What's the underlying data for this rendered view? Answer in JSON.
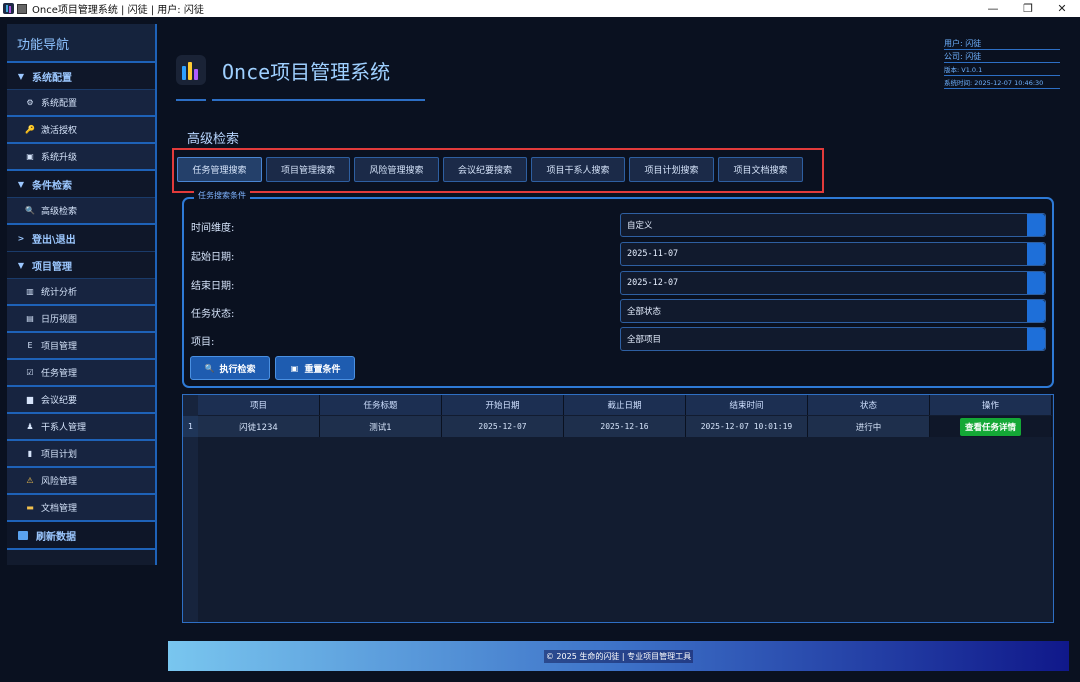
{
  "window": {
    "title": "Once项目管理系统 | 闪徒 | 用户: 闪徒",
    "minimize": "—",
    "maximize": "❐",
    "close": "✕"
  },
  "sidebar": {
    "header": "功能导航",
    "groups": [
      {
        "label": "系统配置",
        "marker": "▼"
      },
      {
        "label": "条件检索",
        "marker": "▼"
      },
      {
        "label": "登出\\退出",
        "marker": ">"
      },
      {
        "label": "项目管理",
        "marker": "▼"
      }
    ],
    "items": [
      {
        "label": "系统配置",
        "icon": "⚙"
      },
      {
        "label": "激活授权",
        "icon": "🔑"
      },
      {
        "label": "系统升级",
        "icon": "▣"
      },
      {
        "label": "高级检索",
        "icon": "🔍"
      },
      {
        "label": "统计分析",
        "icon": "▥"
      },
      {
        "label": "日历视图",
        "icon": "▤"
      },
      {
        "label": "项目管理",
        "icon": "Ε"
      },
      {
        "label": "任务管理",
        "icon": "☑"
      },
      {
        "label": "会议纪要",
        "icon": "▆"
      },
      {
        "label": "干系人管理",
        "icon": "♟"
      },
      {
        "label": "项目计划",
        "icon": "▮"
      },
      {
        "label": "风险管理",
        "icon": "⚠"
      },
      {
        "label": "文档管理",
        "icon": "▬"
      }
    ],
    "refresh": "刷新数据"
  },
  "header": {
    "title": "Once项目管理系统",
    "user": "用户: 闪徒",
    "company": "公司: 闪徒",
    "version": "版本: V1.0.1",
    "systime": "系统时间: 2025-12-07 10:46:30"
  },
  "section_title": "高级检索",
  "tabs": [
    "任务管理搜索",
    "项目管理搜索",
    "风险管理搜索",
    "会议纪要搜索",
    "项目干系人搜索",
    "项目计划搜索",
    "项目文档搜索"
  ],
  "criteria": {
    "legend": "任务搜索条件",
    "time_dim_label": "时间维度:",
    "time_dim_value": "自定义",
    "start_label": "起始日期:",
    "start_value": "2025-11-07",
    "end_label": "结束日期:",
    "end_value": "2025-12-07",
    "status_label": "任务状态:",
    "status_value": "全部状态",
    "project_label": "项目:",
    "project_value": "全部项目",
    "search_btn": "执行检索",
    "reset_btn": "重置条件"
  },
  "table": {
    "columns": [
      "项目",
      "任务标题",
      "开始日期",
      "截止日期",
      "结束时间",
      "状态",
      "操作"
    ],
    "rows": [
      {
        "num": "1",
        "project": "闪徒1234",
        "title": "测试1",
        "start": "2025-12-07",
        "due": "2025-12-16",
        "end": "2025-12-07 10:01:19",
        "status": "进行中",
        "action": "查看任务详情"
      }
    ]
  },
  "footer": {
    "text": "© 2025 生命的闪徒 | 专业项目管理工具"
  },
  "colors": {
    "accent": "#1e6fd9",
    "highlight_box": "#e23b3b",
    "action_button": "#14a836"
  }
}
